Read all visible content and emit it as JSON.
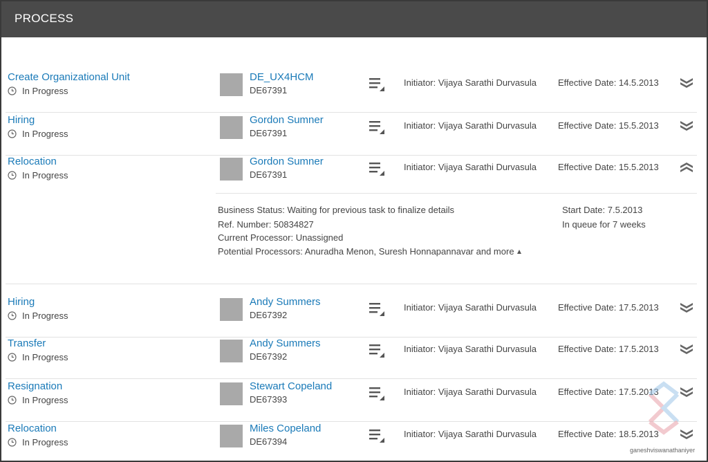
{
  "header": {
    "title": "PROCESS"
  },
  "rows": [
    {
      "process": "Create Organizational Unit",
      "status": "In Progress",
      "employee": "DE_UX4HCM",
      "emp_id": "DE67391",
      "initiator": "Initiator: Vijaya Sarathi Durvasula",
      "effective_date": "Effective Date: 14.5.2013",
      "expanded": false
    },
    {
      "process": "Hiring",
      "status": "In Progress",
      "employee": "Gordon Sumner",
      "emp_id": "DE67391",
      "initiator": "Initiator: Vijaya Sarathi Durvasula",
      "effective_date": "Effective Date: 15.5.2013",
      "expanded": false
    },
    {
      "process": "Relocation",
      "status": "In Progress",
      "employee": "Gordon Sumner",
      "emp_id": "DE67391",
      "initiator": "Initiator: Vijaya Sarathi Durvasula",
      "effective_date": "Effective Date: 15.5.2013",
      "expanded": true
    },
    {
      "process": "Hiring",
      "status": "In Progress",
      "employee": "Andy Summers",
      "emp_id": "DE67392",
      "initiator": "Initiator: Vijaya Sarathi Durvasula",
      "effective_date": "Effective Date: 17.5.2013",
      "expanded": false
    },
    {
      "process": "Transfer",
      "status": "In Progress",
      "employee": "Andy Summers",
      "emp_id": "DE67392",
      "initiator": "Initiator: Vijaya Sarathi Durvasula",
      "effective_date": "Effective Date: 17.5.2013",
      "expanded": false
    },
    {
      "process": "Resignation",
      "status": "In Progress",
      "employee": "Stewart Copeland",
      "emp_id": "DE67393",
      "initiator": "Initiator: Vijaya Sarathi Durvasula",
      "effective_date": "Effective Date: 17.5.2013",
      "expanded": false
    },
    {
      "process": "Relocation",
      "status": "In Progress",
      "employee": "Miles Copeland",
      "emp_id": "DE67394",
      "initiator": "Initiator: Vijaya Sarathi Durvasula",
      "effective_date": "Effective Date: 18.5.2013",
      "expanded": false
    }
  ],
  "details": {
    "business_status": "Business Status: Waiting for previous task to finalize details",
    "ref_number": "Ref. Number: 50834827",
    "current_processor": "Current Processor: Unassigned",
    "potential_processors": "Potential Processors: Anuradha Menon, Suresh Honnapannavar and more",
    "start_date": "Start Date: 7.5.2013",
    "queue": "In queue for 7 weeks"
  },
  "watermark": {
    "text": "ganeshviswanathaniyer"
  },
  "icons": {
    "status": "clock-icon",
    "actions": "menu-lines-icon",
    "collapsed": "chevron-double-down-icon",
    "expanded": "chevron-double-up-icon"
  }
}
